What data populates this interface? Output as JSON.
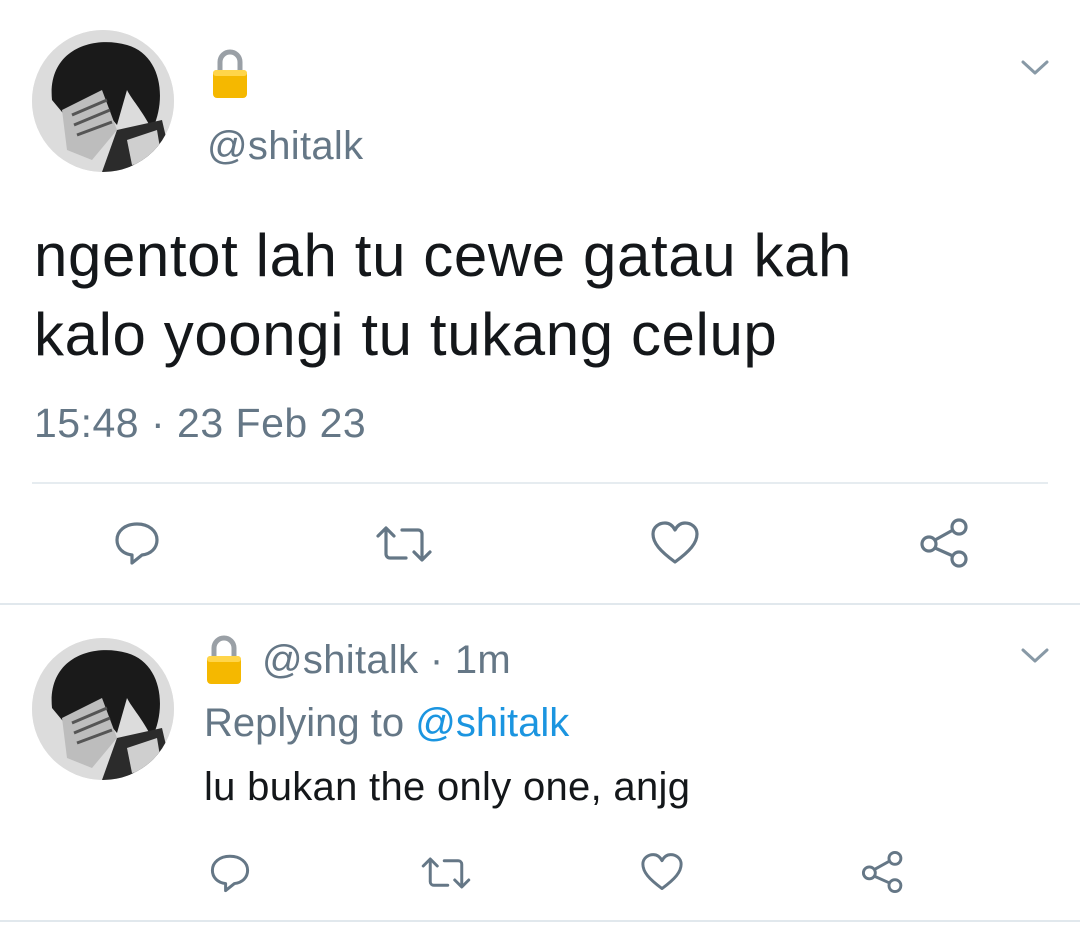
{
  "main_tweet": {
    "handle": "@shitalk",
    "text_line1": "ngentot lah tu cewe gatau kah",
    "text_line2": "kalo yoongi tu tukang celup",
    "timestamp": "15:48 · 23 Feb 23",
    "actions": [
      "reply-icon",
      "retweet-icon",
      "like-icon",
      "share-icon"
    ]
  },
  "reply_tweet": {
    "handle": "@shitalk",
    "separator": "·",
    "age": "1m",
    "replying_prefix": "Replying to",
    "replying_handle": "@shitalk",
    "text": "lu bukan the only one, anjg",
    "actions": [
      "reply-icon",
      "retweet-icon",
      "like-icon",
      "share-icon"
    ]
  },
  "colors": {
    "text_primary": "#14171a",
    "text_secondary": "#657786",
    "link": "#1b95e0",
    "divider": "#e6ecf0",
    "lock_body": "#f5b800"
  }
}
